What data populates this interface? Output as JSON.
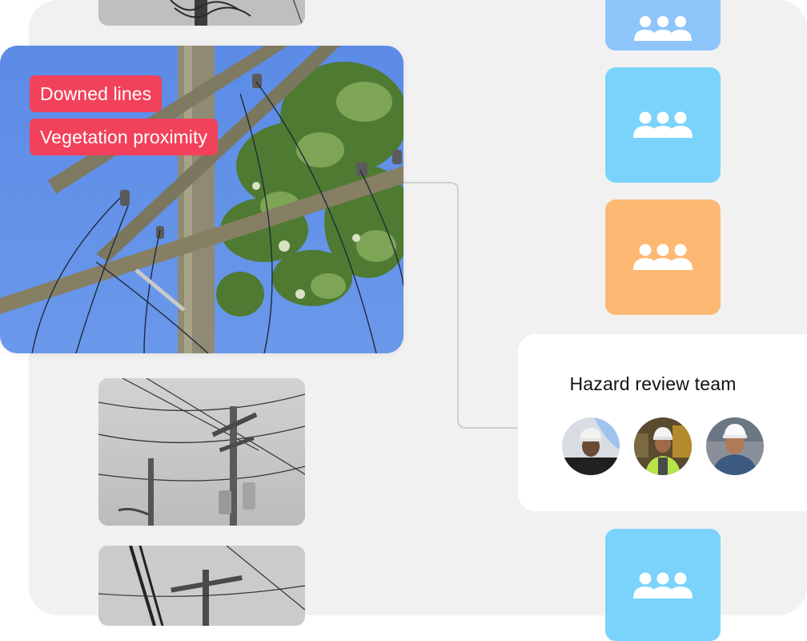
{
  "hero": {
    "tags": [
      "Downed lines",
      "Vegetation proximity"
    ]
  },
  "tiles": [
    {
      "color": "#8ec5fb",
      "icon": "team-icon"
    },
    {
      "color": "#79d3fb",
      "icon": "team-icon"
    },
    {
      "color": "#fdb873",
      "icon": "team-icon"
    },
    {
      "color": "#79d3fb",
      "icon": "team-icon"
    }
  ],
  "review_card": {
    "title": "Hazard review team",
    "members": [
      "avatar-1",
      "avatar-2",
      "avatar-3"
    ]
  },
  "colors": {
    "tag_bg": "#f2415a",
    "canvas_bg": "#f1f1f2",
    "sky": "#5f8fe6"
  }
}
